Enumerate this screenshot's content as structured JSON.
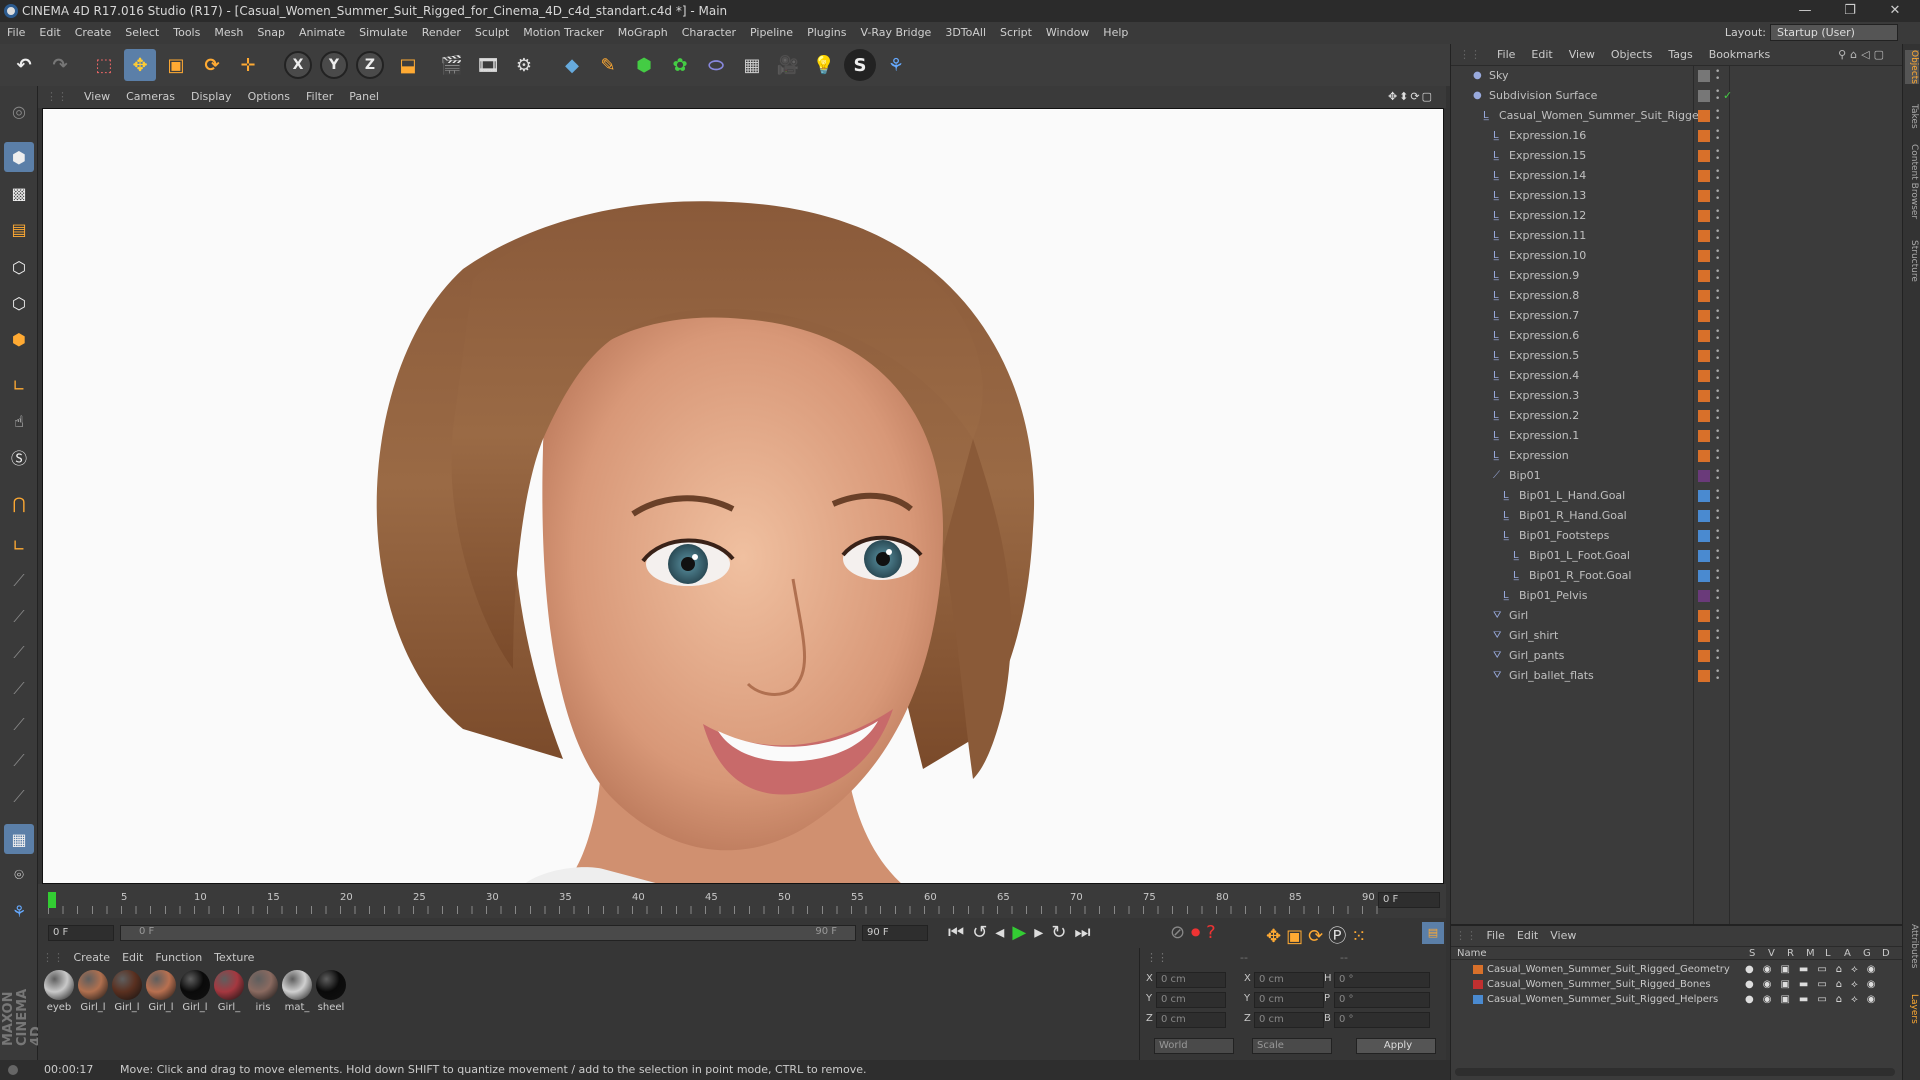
{
  "window": {
    "title": "CINEMA 4D R17.016 Studio (R17) - [Casual_Women_Summer_Suit_Rigged_for_Cinema_4D_c4d_standart.c4d *] - Main",
    "controls": [
      "—",
      "❐",
      "✕"
    ]
  },
  "menu": [
    "File",
    "Edit",
    "Create",
    "Select",
    "Tools",
    "Mesh",
    "Snap",
    "Animate",
    "Simulate",
    "Render",
    "Sculpt",
    "Motion Tracker",
    "MoGraph",
    "Character",
    "Pipeline",
    "Plugins",
    "V-Ray Bridge",
    "3DToAll",
    "Script",
    "Window",
    "Help"
  ],
  "layout": {
    "label": "Layout:",
    "value": "Startup (User)"
  },
  "toolbar": {
    "axes": [
      "X",
      "Y",
      "Z"
    ]
  },
  "viewport": {
    "menu": [
      "View",
      "Cameras",
      "Display",
      "Options",
      "Filter",
      "Panel"
    ]
  },
  "timeline": {
    "ticks": [
      "0",
      "5",
      "10",
      "15",
      "20",
      "25",
      "30",
      "35",
      "40",
      "45",
      "50",
      "55",
      "60",
      "65",
      "70",
      "75",
      "80",
      "85",
      "90"
    ],
    "current_frame": "0 F",
    "start": "0 F",
    "range_start": "0 F",
    "range_end": "90 F",
    "end": "90 F"
  },
  "materials": {
    "menu": [
      "Create",
      "Edit",
      "Function",
      "Texture"
    ],
    "items": [
      {
        "label": "eyeb",
        "color": "#c9c9c9"
      },
      {
        "label": "Girl_l",
        "color": "#b0704f"
      },
      {
        "label": "Girl_l",
        "color": "#5a3020"
      },
      {
        "label": "Girl_l",
        "color": "#b87050"
      },
      {
        "label": "Girl_l",
        "color": "#0a0a0a"
      },
      {
        "label": "Girl_",
        "color": "#a53840"
      },
      {
        "label": "iris",
        "color": "#8a6a60"
      },
      {
        "label": "mat_",
        "color": "#d0d0d0"
      },
      {
        "label": "sheel",
        "color": "#0a0a0a"
      }
    ]
  },
  "coords": {
    "rows": [
      {
        "a": "X",
        "v1": "0 cm",
        "b": "X",
        "v2": "0 cm",
        "c": "H",
        "v3": "0 °"
      },
      {
        "a": "Y",
        "v1": "0 cm",
        "b": "Y",
        "v2": "0 cm",
        "c": "P",
        "v3": "0 °"
      },
      {
        "a": "Z",
        "v1": "0 cm",
        "b": "Z",
        "v2": "0 cm",
        "c": "B",
        "v3": "0 °"
      }
    ],
    "mode": "World",
    "scale": "Scale",
    "apply": "Apply",
    "dashes": "--"
  },
  "status": {
    "time": "00:00:17",
    "message": "Move: Click and drag to move elements. Hold down SHIFT to quantize movement / add to the selection in point mode, CTRL to remove."
  },
  "object_manager": {
    "menu": [
      "File",
      "Edit",
      "View",
      "Objects",
      "Tags",
      "Bookmarks"
    ],
    "objects": [
      {
        "name": "Sky",
        "indent": 0,
        "tag": "#777"
      },
      {
        "name": "Subdivision Surface",
        "indent": 0,
        "tag": "#777",
        "check": "✓"
      },
      {
        "name": "Casual_Women_Summer_Suit_Rigged",
        "indent": 1,
        "tag": "#d8702a"
      },
      {
        "name": "Expression.16",
        "indent": 2,
        "tag": "#d8702a"
      },
      {
        "name": "Expression.15",
        "indent": 2,
        "tag": "#d8702a"
      },
      {
        "name": "Expression.14",
        "indent": 2,
        "tag": "#d8702a"
      },
      {
        "name": "Expression.13",
        "indent": 2,
        "tag": "#d8702a"
      },
      {
        "name": "Expression.12",
        "indent": 2,
        "tag": "#d8702a"
      },
      {
        "name": "Expression.11",
        "indent": 2,
        "tag": "#d8702a"
      },
      {
        "name": "Expression.10",
        "indent": 2,
        "tag": "#d8702a"
      },
      {
        "name": "Expression.9",
        "indent": 2,
        "tag": "#d8702a"
      },
      {
        "name": "Expression.8",
        "indent": 2,
        "tag": "#d8702a"
      },
      {
        "name": "Expression.7",
        "indent": 2,
        "tag": "#d8702a"
      },
      {
        "name": "Expression.6",
        "indent": 2,
        "tag": "#d8702a"
      },
      {
        "name": "Expression.5",
        "indent": 2,
        "tag": "#d8702a"
      },
      {
        "name": "Expression.4",
        "indent": 2,
        "tag": "#d8702a"
      },
      {
        "name": "Expression.3",
        "indent": 2,
        "tag": "#d8702a"
      },
      {
        "name": "Expression.2",
        "indent": 2,
        "tag": "#d8702a"
      },
      {
        "name": "Expression.1",
        "indent": 2,
        "tag": "#d8702a"
      },
      {
        "name": "Expression",
        "indent": 2,
        "tag": "#d8702a"
      },
      {
        "name": "Bip01",
        "indent": 2,
        "tag": "#6a3a7a"
      },
      {
        "name": "Bip01_L_Hand.Goal",
        "indent": 3,
        "tag": "#4a8ad0"
      },
      {
        "name": "Bip01_R_Hand.Goal",
        "indent": 3,
        "tag": "#4a8ad0"
      },
      {
        "name": "Bip01_Footsteps",
        "indent": 3,
        "tag": "#4a8ad0"
      },
      {
        "name": "Bip01_L_Foot.Goal",
        "indent": 4,
        "tag": "#4a8ad0"
      },
      {
        "name": "Bip01_R_Foot.Goal",
        "indent": 4,
        "tag": "#4a8ad0"
      },
      {
        "name": "Bip01_Pelvis",
        "indent": 3,
        "tag": "#6a3a7a"
      },
      {
        "name": "Girl",
        "indent": 2,
        "tag": "#d8702a"
      },
      {
        "name": "Girl_shirt",
        "indent": 2,
        "tag": "#d8702a"
      },
      {
        "name": "Girl_pants",
        "indent": 2,
        "tag": "#d8702a"
      },
      {
        "name": "Girl_ballet_flats",
        "indent": 2,
        "tag": "#d8702a"
      }
    ]
  },
  "layer_manager": {
    "menu": [
      "File",
      "Edit",
      "View"
    ],
    "header": {
      "name": "Name",
      "cols": [
        "S",
        "V",
        "R",
        "M",
        "L",
        "A",
        "G",
        "D"
      ]
    },
    "layers": [
      {
        "name": "Casual_Women_Summer_Suit_Rigged_Geometry",
        "color": "#d8702a"
      },
      {
        "name": "Casual_Women_Summer_Suit_Rigged_Bones",
        "color": "#c03030"
      },
      {
        "name": "Casual_Women_Summer_Suit_Rigged_Helpers",
        "color": "#4a8ad0"
      }
    ]
  },
  "side_tabs": [
    "Objects",
    "Takes",
    "Content Browser",
    "Structure",
    "Attributes",
    "Layers"
  ],
  "brand": "MAXON CINEMA 4D"
}
